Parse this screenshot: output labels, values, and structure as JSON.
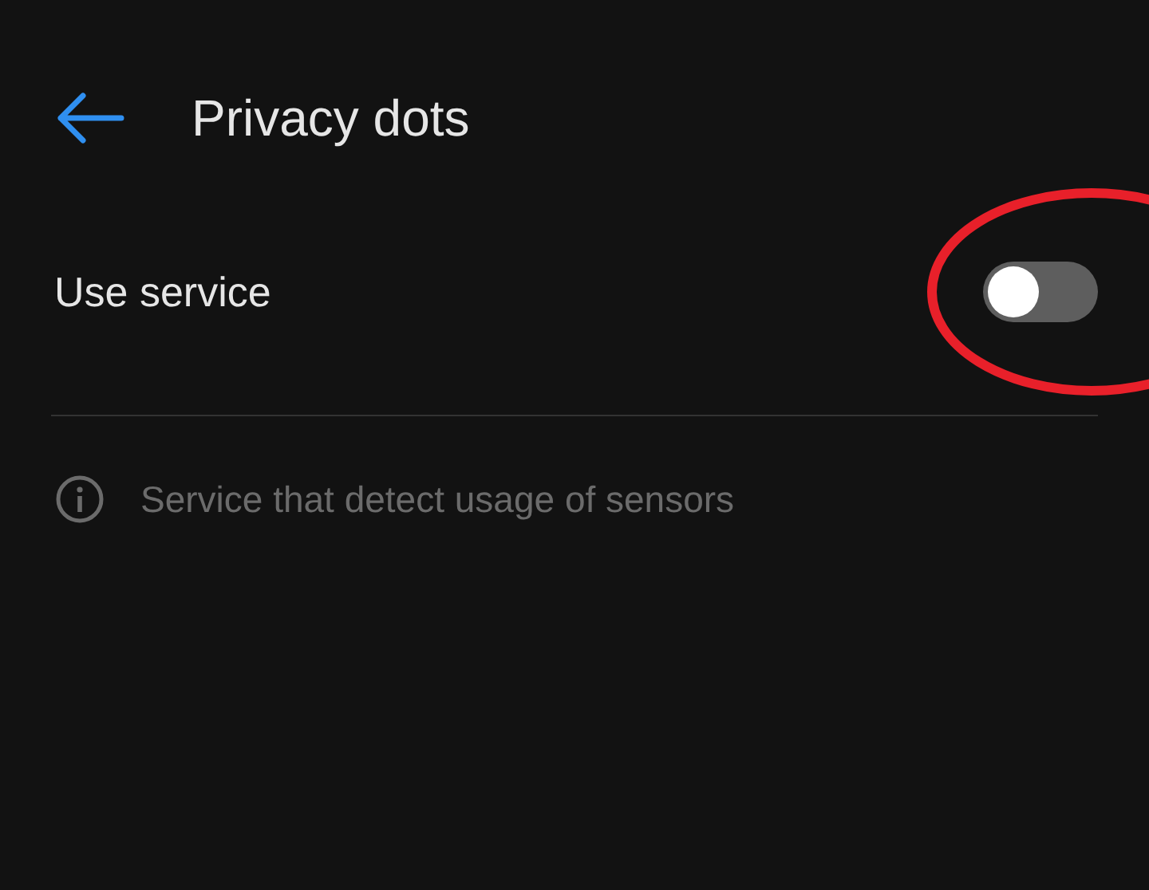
{
  "header": {
    "title": "Privacy dots"
  },
  "setting": {
    "label": "Use service",
    "on": false
  },
  "info": {
    "text": "Service that detect usage of sensors"
  }
}
